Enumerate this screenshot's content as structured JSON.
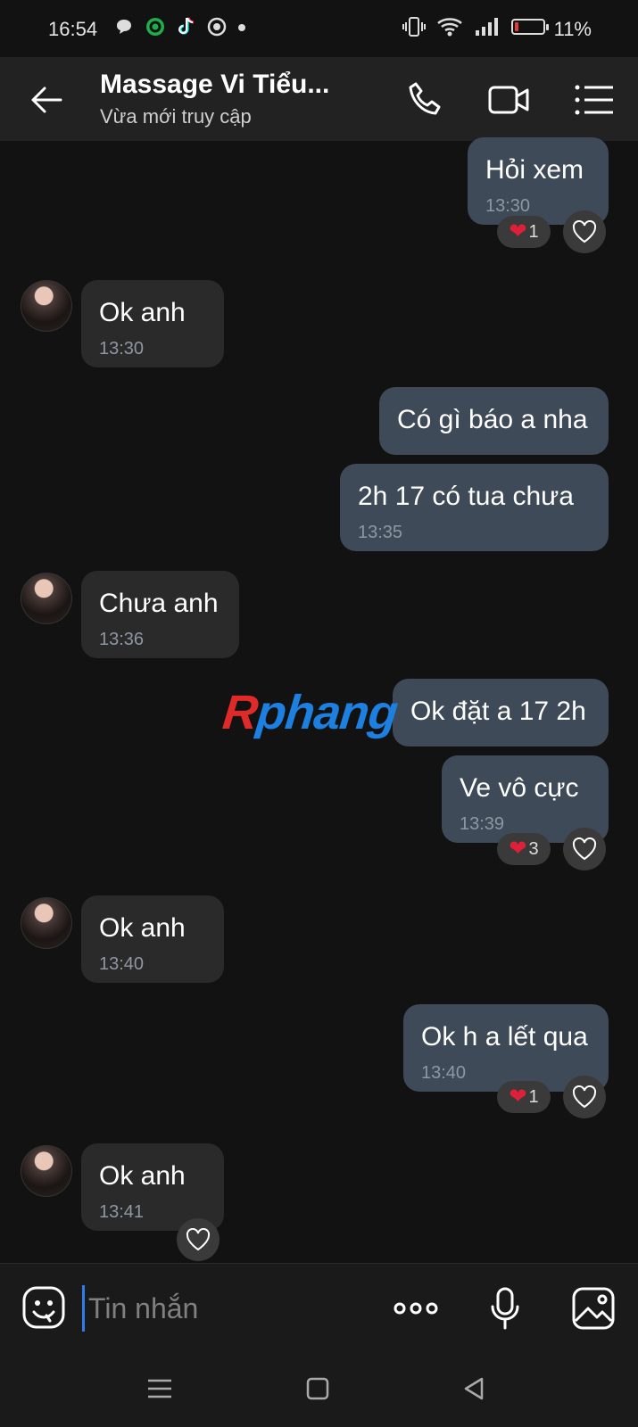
{
  "status_bar": {
    "time": "16:54",
    "battery_percent": "11%",
    "battery_level": 0.11,
    "left_icons": [
      "chat-bubble-icon",
      "grab-icon",
      "tiktok-icon",
      "target-icon",
      "dot-icon"
    ],
    "right_icons": [
      "vibrate-icon",
      "wifi-icon",
      "signal-icon",
      "battery-icon"
    ]
  },
  "header": {
    "title": "Massage Vi Tiểu...",
    "subtitle": "Vừa mới truy cập",
    "icons": [
      "back-arrow-icon",
      "phone-icon",
      "video-call-icon",
      "menu-list-icon"
    ]
  },
  "messages": [
    {
      "dir": "out",
      "text": "Hỏi xem",
      "time": "13:30",
      "reaction": {
        "emoji": "heart",
        "count": "1"
      }
    },
    {
      "dir": "in",
      "text": "Ok anh",
      "time": "13:30"
    },
    {
      "dir": "out",
      "text": "Có gì báo a nha",
      "time": ""
    },
    {
      "dir": "out",
      "text": "2h 17 có tua chưa",
      "time": "13:35"
    },
    {
      "dir": "in",
      "text": "Chưa anh",
      "time": "13:36"
    },
    {
      "dir": "out",
      "text": "Ok đặt a 17 2h",
      "time": ""
    },
    {
      "dir": "out",
      "text": "Ve vô cực",
      "time": "13:39",
      "reaction": {
        "emoji": "heart",
        "count": "3"
      }
    },
    {
      "dir": "in",
      "text": "Ok anh",
      "time": "13:40"
    },
    {
      "dir": "out",
      "text": "Ok h a lết qua",
      "time": "13:40",
      "reaction": {
        "emoji": "heart",
        "count": "1"
      }
    },
    {
      "dir": "in",
      "text": "Ok anh",
      "time": "13:41"
    }
  ],
  "watermark": {
    "first": "R",
    "rest": "phang"
  },
  "composer": {
    "placeholder": "Tin nhắn",
    "icons": [
      "emoji-icon",
      "more-options-icon",
      "microphone-icon",
      "image-icon"
    ]
  },
  "nav_bar": {
    "icons": [
      "recents-icon",
      "home-icon",
      "back-icon"
    ]
  },
  "colors": {
    "background": "#121212",
    "outgoing_bubble": "#3e4a58",
    "incoming_bubble": "#2a2a2a",
    "reaction_heart": "#e0203a",
    "cursor": "#2f7de8"
  }
}
